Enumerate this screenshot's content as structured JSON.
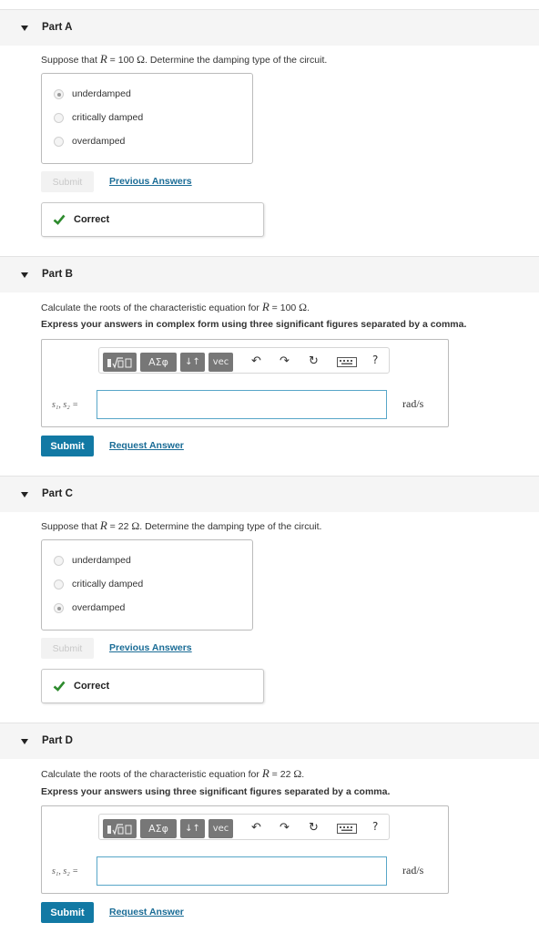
{
  "partA": {
    "title": "Part A",
    "question_pre": "Suppose that ",
    "var": "R",
    "question_mid": " = 100 ",
    "unit": "Ω",
    "question_post": ". Determine the damping type of the circuit.",
    "choices": [
      {
        "label": "underdamped",
        "selected": true
      },
      {
        "label": "critically damped",
        "selected": false
      },
      {
        "label": "overdamped",
        "selected": false
      }
    ],
    "submit_label": "Submit",
    "link_label": "Previous Answers",
    "feedback": "Correct"
  },
  "partB": {
    "title": "Part B",
    "question_pre": "Calculate the roots of the characteristic equation for ",
    "var": "R",
    "question_mid": " = 100 ",
    "unit": "Ω",
    "question_post": ".",
    "instruction": "Express your answers in complex form using three significant figures separated by a comma.",
    "answer_label": "s₁, s₂ =",
    "answer_value": "",
    "answer_unit": "rad/s",
    "submit_label": "Submit",
    "link_label": "Request Answer"
  },
  "partC": {
    "title": "Part C",
    "question_pre": "Suppose that ",
    "var": "R",
    "question_mid": " = 22 ",
    "unit": "Ω",
    "question_post": ". Determine the damping type of the circuit.",
    "choices": [
      {
        "label": "underdamped",
        "selected": false
      },
      {
        "label": "critically damped",
        "selected": false
      },
      {
        "label": "overdamped",
        "selected": true
      }
    ],
    "submit_label": "Submit",
    "link_label": "Previous Answers",
    "feedback": "Correct"
  },
  "partD": {
    "title": "Part D",
    "question_pre": "Calculate the roots of the characteristic equation for ",
    "var": "R",
    "question_mid": " = 22 ",
    "unit": "Ω",
    "question_post": ".",
    "instruction": "Express your answers using three significant figures separated by a comma.",
    "answer_label": "s₁, s₂ =",
    "answer_value": "",
    "answer_unit": "rad/s",
    "submit_label": "Submit",
    "link_label": "Request Answer"
  },
  "toolbar": {
    "templates_icon": "templates-icon",
    "greek_label": "ΑΣφ",
    "subsup_label": "↓↑",
    "vec_label": "vec",
    "undo_icon": "undo-icon",
    "redo_icon": "redo-icon",
    "reset_icon": "reset-icon",
    "keyboard_icon": "keyboard-icon",
    "help_label": "?"
  },
  "colors": {
    "submit_bg": "#1279a4",
    "link": "#1a6c96",
    "check": "#2e8b2e",
    "input_border": "#58a6c8"
  }
}
